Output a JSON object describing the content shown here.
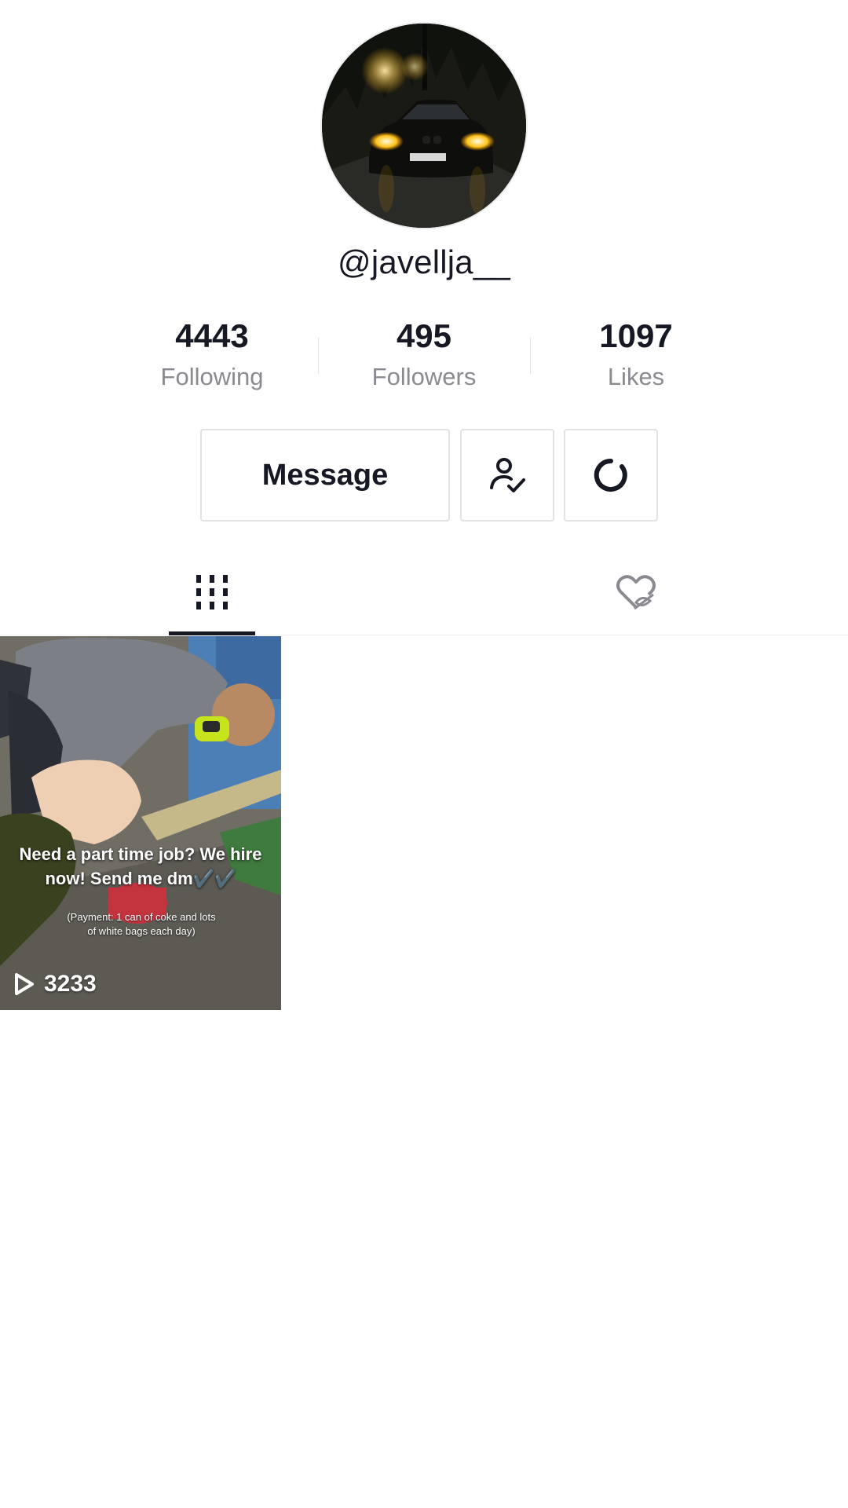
{
  "profile": {
    "username": "@javellja__",
    "avatar_icon": "profile-photo-car-headlights"
  },
  "stats": {
    "following": {
      "value": "4443",
      "label": "Following"
    },
    "followers": {
      "value": "495",
      "label": "Followers"
    },
    "likes": {
      "value": "1097",
      "label": "Likes"
    }
  },
  "actions": {
    "message_label": "Message",
    "following_icon": "user-check-icon",
    "suggested_icon": "refresh-icon"
  },
  "tabs": [
    {
      "name": "videos",
      "icon": "grid-icon",
      "active": true
    },
    {
      "name": "liked",
      "icon": "heart-hidden-icon",
      "active": false
    }
  ],
  "videos": [
    {
      "caption": "Need a part time job? We hire now! Send me dm✔️✔️",
      "caption_small": "(Payment: 1 can of coke and lots of white bags each day)",
      "views": "3233"
    }
  ],
  "colors": {
    "text": "#161823",
    "secondary": "#8a8b91",
    "border": "#e3e3e4"
  }
}
